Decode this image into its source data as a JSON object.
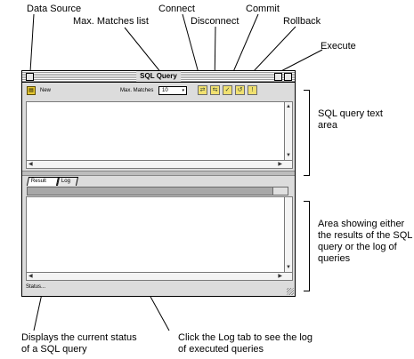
{
  "callouts": {
    "data_source": "Data Source",
    "max_matches": "Max. Matches list",
    "connect": "Connect",
    "disconnect": "Disconnect",
    "commit": "Commit",
    "rollback": "Rollback",
    "execute": "Execute",
    "sql_area": "SQL query text area",
    "results_area": "Area showing either the results of the SQL query or the log of queries",
    "status_desc": "Displays the current status of a SQL query",
    "log_tab_desc": "Click the Log tab to see the log of executed queries"
  },
  "window": {
    "title": "SQL Query",
    "toolbar": {
      "data_source_label": "New",
      "max_matches_label": "Max. Matches",
      "max_matches_value": "10"
    },
    "tabs": [
      {
        "label": "Result"
      },
      {
        "label": "Log"
      }
    ],
    "status_text": "Status..."
  },
  "icons": {
    "data_source": "database-icon",
    "connect": "connect-icon",
    "disconnect": "disconnect-icon",
    "commit": "commit-icon",
    "rollback": "rollback-icon",
    "execute": "execute-icon"
  }
}
